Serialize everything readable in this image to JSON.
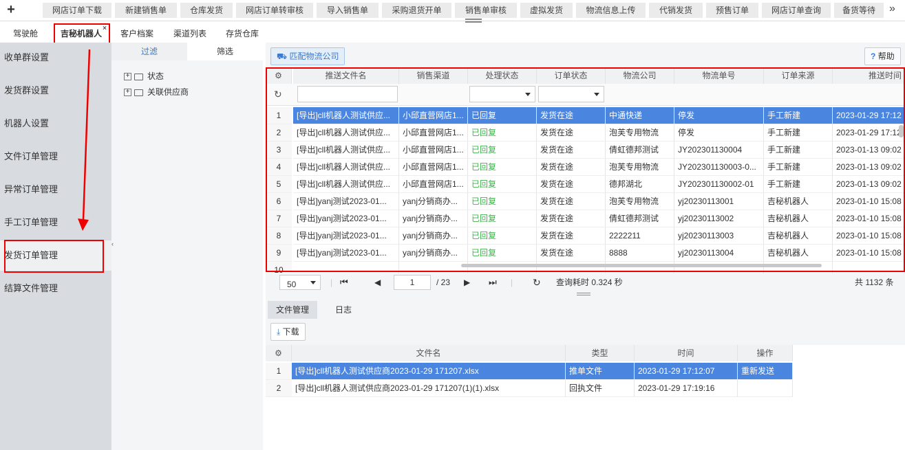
{
  "topnav": {
    "plus": "+",
    "more": "»",
    "buttons": [
      "网店订单下载",
      "新建销售单",
      "仓库发货",
      "网店订单转审核",
      "导入销售单",
      "采购退货开单",
      "销售单审核",
      "虚拟发货",
      "物流信息上传",
      "代销发货",
      "预售订单",
      "网店订单查询",
      "备货等待"
    ]
  },
  "tabs": [
    {
      "label": "驾驶舱"
    },
    {
      "label": "吉秘机器人",
      "active": true,
      "close": "×"
    },
    {
      "label": "客户档案"
    },
    {
      "label": "渠道列表"
    },
    {
      "label": "存货仓库"
    }
  ],
  "sidebar": {
    "items": [
      "收单群设置",
      "发货群设置",
      "机器人设置",
      "文件订单管理",
      "异常订单管理",
      "手工订单管理",
      "发货订单管理",
      "结算文件管理"
    ],
    "active_index": 6
  },
  "leftpanel": {
    "tabs": [
      "过滤",
      "筛选"
    ],
    "tree": [
      "状态",
      "关联供应商"
    ]
  },
  "main": {
    "match_button": "匹配物流公司",
    "help_button": "帮助",
    "help_icon": "?",
    "columns": [
      "推送文件名",
      "销售渠道",
      "处理状态",
      "订单状态",
      "物流公司",
      "物流单号",
      "订单来源",
      "推送时间"
    ],
    "rows": [
      [
        "1",
        "[导出]cll机器人测试供应...",
        "小邱直营网店1...",
        "已回复",
        "发货在途",
        "中通快递",
        "停发",
        "手工新建",
        "2023-01-29 17:12"
      ],
      [
        "2",
        "[导出]cll机器人测试供应...",
        "小邱直营网店1...",
        "已回复",
        "发货在途",
        "泡芙专用物流",
        "停发",
        "手工新建",
        "2023-01-29 17:12"
      ],
      [
        "3",
        "[导出]cll机器人测试供应...",
        "小邱直营网店1...",
        "已回复",
        "发货在途",
        "倩虹德邦测试",
        "JY202301130004",
        "手工新建",
        "2023-01-13 09:02"
      ],
      [
        "4",
        "[导出]cll机器人测试供应...",
        "小邱直营网店1...",
        "已回复",
        "发货在途",
        "泡芙专用物流",
        "JY202301130003-0...",
        "手工新建",
        "2023-01-13 09:02"
      ],
      [
        "5",
        "[导出]cll机器人测试供应...",
        "小邱直营网店1...",
        "已回复",
        "发货在途",
        "德邦湖北",
        "JY202301130002-01",
        "手工新建",
        "2023-01-13 09:02"
      ],
      [
        "6",
        "[导出]yanj测试2023-01...",
        "yanj分销商办...",
        "已回复",
        "发货在途",
        "泡芙专用物流",
        "yj20230113001",
        "吉秘机器人",
        "2023-01-10 15:08"
      ],
      [
        "7",
        "[导出]yanj测试2023-01...",
        "yanj分销商办...",
        "已回复",
        "发货在途",
        "倩虹德邦测试",
        "yj20230113002",
        "吉秘机器人",
        "2023-01-10 15:08"
      ],
      [
        "8",
        "[导出]yanj测试2023-01...",
        "yanj分销商办...",
        "已回复",
        "发货在途",
        "2222211",
        "yj20230113003",
        "吉秘机器人",
        "2023-01-10 15:08"
      ],
      [
        "9",
        "[导出]yanj测试2023-01...",
        "yanj分销商办...",
        "已回复",
        "发货在途",
        "8888",
        "yj20230113004",
        "吉秘机器人",
        "2023-01-10 15:08"
      ],
      [
        "10",
        "",
        "",
        "",
        "",
        "",
        "",
        "",
        ""
      ]
    ],
    "selected_row": 0
  },
  "pager": {
    "page_size": "50",
    "page": "1",
    "total_pages": "/ 23",
    "query_time": "查询耗时 0.324 秒",
    "total": "共 1132 条"
  },
  "bottom": {
    "tabs": [
      "文件管理",
      "日志"
    ],
    "download": "下载",
    "columns": [
      "文件名",
      "类型",
      "时间",
      "操作"
    ],
    "rows": [
      [
        "1",
        "[导出]cll机器人测试供应商2023-01-29 171207.xlsx",
        "推单文件",
        "2023-01-29 17:12:07",
        "重新发送"
      ],
      [
        "2",
        "[导出]cll机器人测试供应商2023-01-29 171207(1)(1).xlsx",
        "回执文件",
        "2023-01-29 17:19:16",
        ""
      ]
    ]
  },
  "colors": {
    "accent": "#3a7ad0",
    "selected_row": "#4a86e0",
    "status_green": "#3cb34a",
    "highlight_box": "#e00000"
  }
}
